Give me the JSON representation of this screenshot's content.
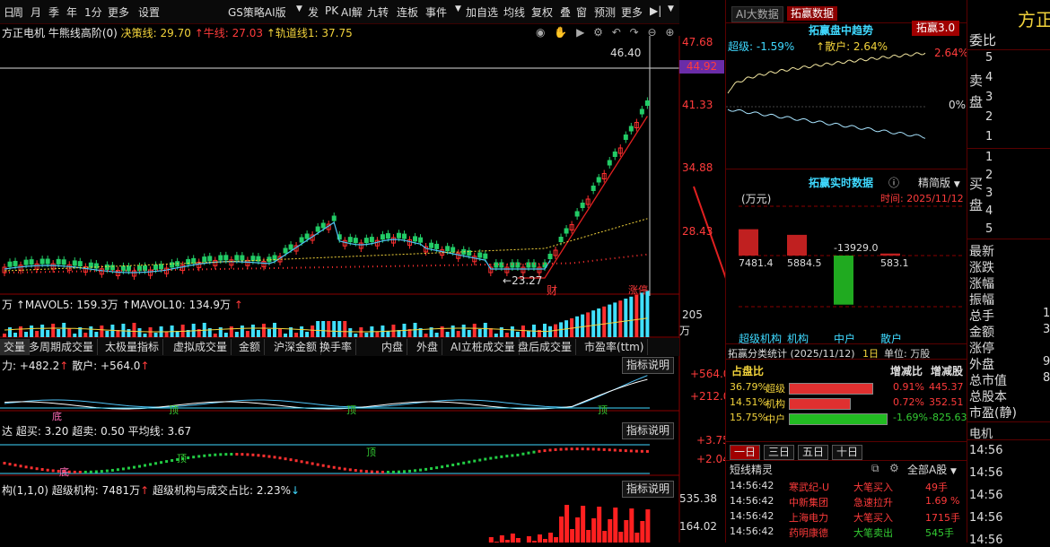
{
  "toolbar": {
    "items": [
      "日",
      "周",
      "月",
      "季",
      "年",
      "1分",
      "更多",
      "设置",
      "GS策略AI版",
      "发",
      "PK",
      "AI解",
      "九转",
      "连板",
      "事件",
      "加自选",
      "均线",
      "复权",
      "叠",
      "窗",
      "预测",
      "更多"
    ],
    "collapse_icon": "collapse-right-icon"
  },
  "main": {
    "stock_name": "方正电机",
    "indicator": "牛熊线高阶(0)",
    "decision_label": "决策线: 29.70",
    "bull_label": "牛线: 27.03",
    "track_label": "轨道线1: 37.75",
    "price_axis": [
      "47.68",
      "44.92",
      "41.33",
      "34.88",
      "28.43"
    ],
    "current_price": "44.92",
    "high_label": "46.40",
    "low_label": "23.27",
    "marker_cai": "财",
    "marker_zhangting": "涨停"
  },
  "volume": {
    "label_prefix": "万",
    "mavol5": "MAVOL5: 159.3万",
    "mavol10": "MAVOL10: 134.9万",
    "axis_top": "205",
    "axis_unit": "万"
  },
  "tabs": [
    "交量",
    "多周期成交量",
    "太极量指标",
    "虚拟成交量",
    "金额",
    "沪深金额",
    "换手率",
    "内盘",
    "外盘",
    "AI立桩成交量",
    "盘后成交量",
    "市盈率(ttm)"
  ],
  "ind1": {
    "label1": "力: +482.2",
    "label2": "散户: +564.0",
    "axis_top": "+564.0",
    "axis_mid": "+212.0",
    "explain": "指标说明",
    "mark_ding": "顶",
    "mark_di": "底"
  },
  "ind2": {
    "label": "达  超买: 3.20  超卖: 0.50  平均线: 3.67",
    "axis_top": "+3.75",
    "axis_mid": "+2.04",
    "explain": "指标说明",
    "mark_ding": "顶",
    "mark_di": "底"
  },
  "ind3": {
    "label": "构(1,1,0)  超级机构: 7481万",
    "label2": "超级机构与成交占比: 2.23%",
    "axis_top": "535.38",
    "axis_mid": "164.02",
    "explain": "指标说明"
  },
  "right": {
    "tab_ai": "AI大数据",
    "tab_tuoying": "拓赢数据",
    "intraday_title": "拓赢盘中趋势",
    "version_btn": "拓赢3.0",
    "super_label": "超级: -1.59%",
    "retail_label": "散户: 2.64%",
    "pct_top": "2.64%",
    "pct_zero": "0%",
    "realtime_title": "拓赢实时数据",
    "info_icon": "info-icon",
    "mode_select": "精简版",
    "unit": "(万元)",
    "time_label": "时间: 2025/11/12",
    "bar_values": [
      "7481.4",
      "5884.5",
      "-13929.0",
      "583.1"
    ],
    "bar_categories": [
      "超级机构",
      "机构",
      "中户",
      "散户"
    ],
    "stat_title": "拓赢分类统计 (2025/11/12)",
    "stat_period": "1日",
    "stat_unit": "单位: 万股",
    "stat_headers": [
      "占盘比",
      "增减比",
      "增减股"
    ],
    "stat_rows": [
      {
        "pct": "36.79%",
        "name": "超级",
        "chg": "0.91%",
        "shares": "445.37",
        "color": "#e03030",
        "fill": 0.85
      },
      {
        "pct": "14.51%",
        "name": "机构",
        "chg": "0.72%",
        "shares": "352.51",
        "color": "#e03030",
        "fill": 0.62
      },
      {
        "pct": "15.75%",
        "name": "中户",
        "chg": "-1.69%",
        "shares": "-825.63",
        "color": "#22bb22",
        "fill": 1.0
      }
    ],
    "period_tabs": [
      "一日",
      "三日",
      "五日",
      "十日"
    ],
    "elf_title": "短线精灵",
    "elf_filter": "全部A股",
    "elf_rows": [
      {
        "time": "14:56:42",
        "name": "寒武纪-U",
        "event": "大笔买入",
        "val": "49手",
        "color": "#ff3b3b"
      },
      {
        "time": "14:56:42",
        "name": "中新集团",
        "event": "急速拉升",
        "val": "1.69 %",
        "color": "#ff3b3b"
      },
      {
        "time": "14:56:42",
        "name": "上海电力",
        "event": "大笔买入",
        "val": "1715手",
        "color": "#ff3b3b"
      },
      {
        "time": "14:56:42",
        "name": "药明康德",
        "event": "大笔卖出",
        "val": "545手",
        "color": "#33cc33"
      }
    ]
  },
  "farright": {
    "title": "方正",
    "weibi": "委比",
    "sell_label": "卖盘",
    "buy_label": "买盘",
    "sell_levels": [
      "5",
      "4",
      "3",
      "2",
      "1"
    ],
    "buy_levels": [
      "1",
      "2",
      "3",
      "4",
      "5"
    ],
    "fields": [
      "最新",
      "涨跌",
      "涨幅",
      "振幅",
      "总手",
      "金额",
      "涨停",
      "外盘",
      "总市值",
      "总股本",
      "市盈(静)"
    ],
    "field_vals": [
      "",
      "",
      "",
      "",
      "1",
      "3",
      "",
      "9",
      "8",
      "",
      ""
    ],
    "elec": "电机",
    "times": [
      "14:56",
      "14:56",
      "14:56",
      "14:56",
      "14:56"
    ]
  }
}
